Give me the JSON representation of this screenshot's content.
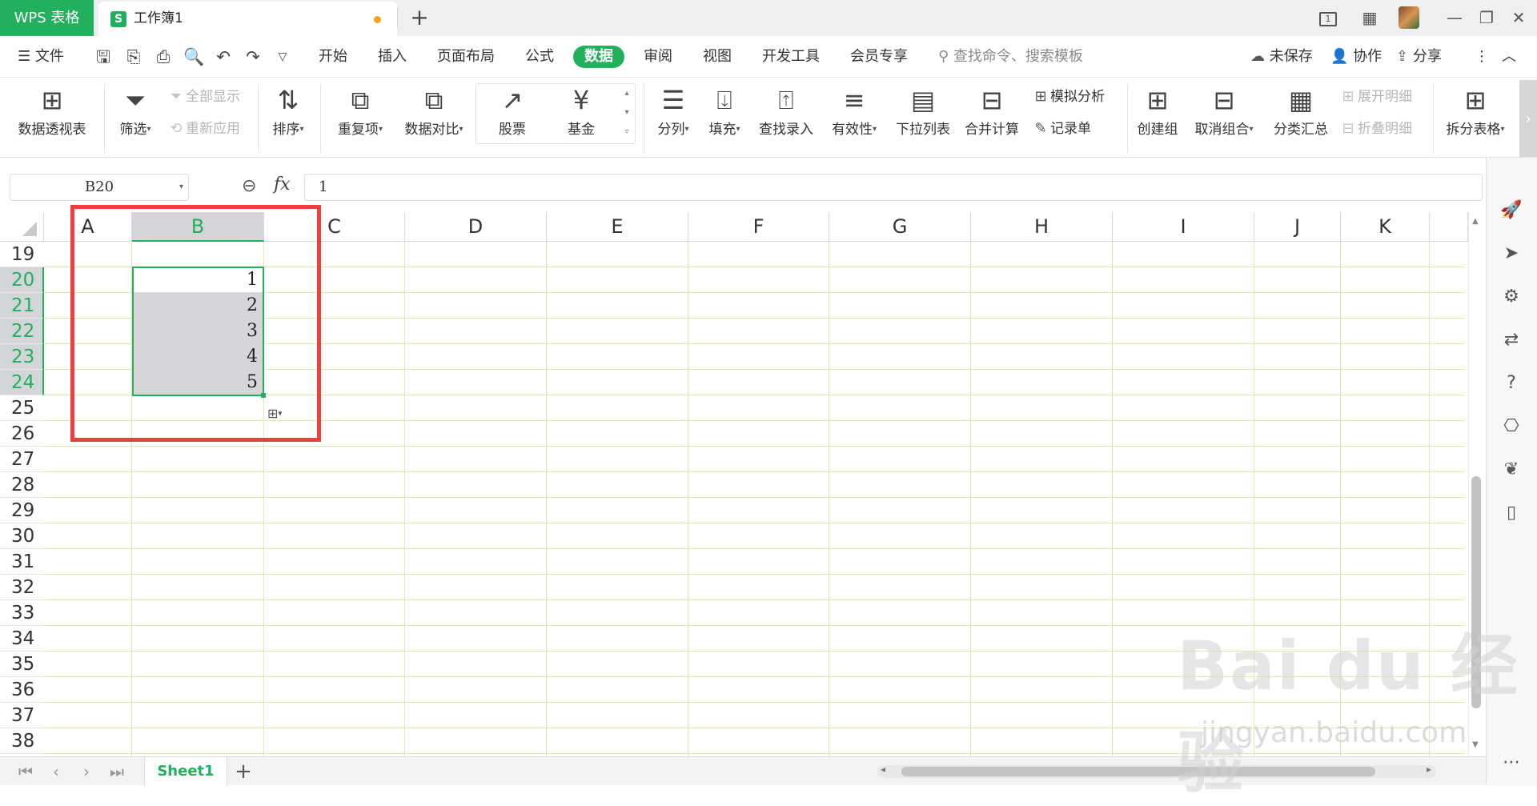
{
  "titlebar": {
    "app_name": "WPS 表格",
    "doc_icon_letter": "S",
    "doc_title": "工作簿1",
    "new_tab": "+",
    "page_badge": "1"
  },
  "menubar": {
    "file": "文件",
    "tabs": [
      "开始",
      "插入",
      "页面布局",
      "公式",
      "数据",
      "审阅",
      "视图",
      "开发工具",
      "会员专享"
    ],
    "active_tab": "数据",
    "search_placeholder": "查找命令、搜索模板",
    "unsaved": "未保存",
    "collaborate": "协作",
    "share": "分享"
  },
  "ribbon": {
    "pivot": "数据透视表",
    "filter": "筛选",
    "show_all": "全部显示",
    "reapply": "重新应用",
    "sort": "排序",
    "duplicates": "重复项",
    "compare": "数据对比",
    "stock": "股票",
    "fund": "基金",
    "split_col": "分列",
    "fill": "填充",
    "lookup_entry": "查找录入",
    "validity": "有效性",
    "dropdown_list": "下拉列表",
    "consolidate": "合并计算",
    "what_if": "模拟分析",
    "record_form": "记录单",
    "create_group": "创建组",
    "ungroup": "取消组合",
    "subtotal": "分类汇总",
    "expand_detail": "展开明细",
    "collapse_detail": "折叠明细",
    "split_table": "拆分表格"
  },
  "formula_bar": {
    "name_box": "B20",
    "fx": "fx",
    "value": "1"
  },
  "grid": {
    "columns": [
      "A",
      "B",
      "C",
      "D",
      "E",
      "F",
      "G",
      "H",
      "I",
      "J",
      "K"
    ],
    "selected_column": "B",
    "rows": [
      "19",
      "20",
      "21",
      "22",
      "23",
      "24",
      "25",
      "26",
      "27",
      "28",
      "29",
      "30",
      "31",
      "32",
      "33",
      "34",
      "35",
      "36",
      "37",
      "38"
    ],
    "selected_rows": [
      "20",
      "21",
      "22",
      "23",
      "24"
    ],
    "values": [
      {
        "cell": "B20",
        "value": "1"
      },
      {
        "cell": "B21",
        "value": "2"
      },
      {
        "cell": "B22",
        "value": "3"
      },
      {
        "cell": "B23",
        "value": "4"
      },
      {
        "cell": "B24",
        "value": "5"
      }
    ]
  },
  "sheetbar": {
    "sheets": [
      "Sheet1"
    ],
    "active_sheet": "Sheet1",
    "add": "+"
  },
  "watermark": {
    "brand": "Bai du 经验",
    "url": "jingyan.baidu.com"
  },
  "colors": {
    "accent": "#22b05c",
    "annotation": "#ee3f3f",
    "gridline": "#dde9b0",
    "unsaved_dot": "#f2a417"
  },
  "icons": [
    "menu-icon",
    "save-icon",
    "export-icon",
    "print-icon",
    "preview-icon",
    "undo-icon",
    "redo-icon",
    "search-icon",
    "cloud-icon",
    "user-icon",
    "share-icon",
    "more-icon",
    "collapse-icon",
    "zoom-icon",
    "fx-icon",
    "rocket-icon",
    "cursor-icon",
    "sliders-icon",
    "transform-icon",
    "help-icon",
    "backup-icon",
    "leaf-icon",
    "book-icon"
  ]
}
